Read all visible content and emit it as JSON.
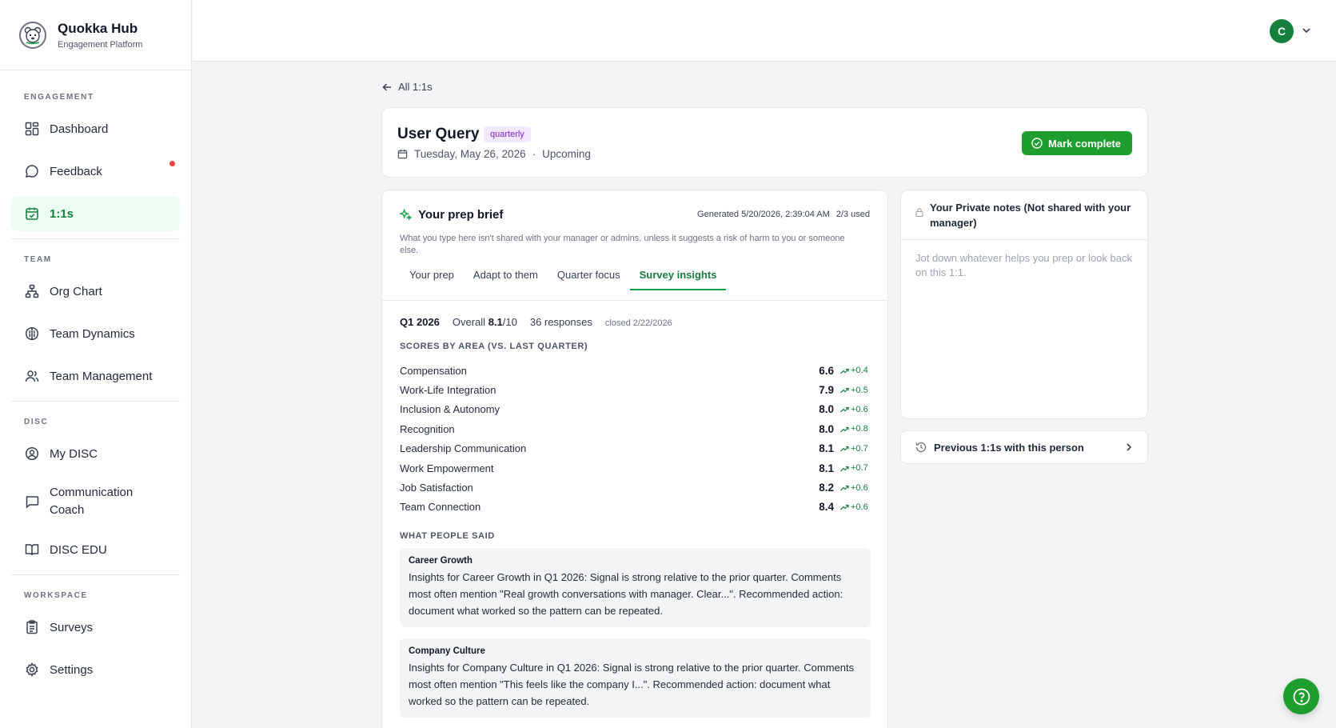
{
  "brand": {
    "name": "Quokka Hub",
    "subtitle": "Engagement Platform"
  },
  "sidebar": {
    "sections": [
      {
        "label": "ENGAGEMENT",
        "items": [
          {
            "label": "Dashboard",
            "icon": "dashboard-icon"
          },
          {
            "label": "Feedback",
            "icon": "chat-bubble-icon",
            "notification": true
          },
          {
            "label": "1:1s",
            "icon": "calendar-check-icon",
            "active": true
          }
        ]
      },
      {
        "label": "TEAM",
        "items": [
          {
            "label": "Org Chart",
            "icon": "org-chart-icon"
          },
          {
            "label": "Team Dynamics",
            "icon": "brain-icon"
          },
          {
            "label": "Team Management",
            "icon": "users-icon"
          }
        ]
      },
      {
        "label": "DISC",
        "items": [
          {
            "label": "My DISC",
            "icon": "user-circle-icon"
          },
          {
            "label": "Communication Coach",
            "icon": "message-square-icon"
          },
          {
            "label": "DISC EDU",
            "icon": "book-open-icon"
          }
        ]
      },
      {
        "label": "WORKSPACE",
        "items": [
          {
            "label": "Surveys",
            "icon": "clipboard-icon"
          },
          {
            "label": "Settings",
            "icon": "gear-icon"
          }
        ]
      }
    ]
  },
  "topbar": {
    "avatar_initial": "C"
  },
  "back_link": "All 1:1s",
  "meeting": {
    "title": "User Query",
    "badge": "quarterly",
    "date": "Tuesday, May 26, 2026",
    "separator": "·",
    "status": "Upcoming",
    "complete_label": "Mark complete"
  },
  "brief": {
    "title": "Your prep brief",
    "generated": "Generated 5/20/2026, 2:39:04 AM",
    "usage": "2/3 used",
    "disclaimer": "What you type here isn't shared with your manager or admins, unless it suggests a risk of harm to you or someone else.",
    "tabs": [
      "Your prep",
      "Adapt to them",
      "Quarter focus",
      "Survey insights"
    ],
    "active_tab": 3,
    "summary": {
      "quarter": "Q1 2026",
      "overall_label": "Overall",
      "overall_value": "8.1",
      "overall_suffix": "/10",
      "responses": "36 responses",
      "closed": "closed 2/22/2026"
    },
    "scores_label": "SCORES BY AREA (VS. LAST QUARTER)",
    "scores": [
      {
        "name": "Compensation",
        "value": "6.6",
        "delta": "+0.4"
      },
      {
        "name": "Work-Life Integration",
        "value": "7.9",
        "delta": "+0.5"
      },
      {
        "name": "Inclusion & Autonomy",
        "value": "8.0",
        "delta": "+0.6"
      },
      {
        "name": "Recognition",
        "value": "8.0",
        "delta": "+0.8"
      },
      {
        "name": "Leadership Communication",
        "value": "8.1",
        "delta": "+0.7"
      },
      {
        "name": "Work Empowerment",
        "value": "8.1",
        "delta": "+0.7"
      },
      {
        "name": "Job Satisfaction",
        "value": "8.2",
        "delta": "+0.6"
      },
      {
        "name": "Team Connection",
        "value": "8.4",
        "delta": "+0.6"
      }
    ],
    "said_label": "WHAT PEOPLE SAID",
    "quotes": [
      {
        "title": "Career Growth",
        "body": "Insights for Career Growth in Q1 2026: Signal is strong relative to the prior quarter. Comments most often mention \"Real growth conversations with manager. Clear...\". Recommended action: document what worked so the pattern can be repeated."
      },
      {
        "title": "Company Culture",
        "body": "Insights for Company Culture in Q1 2026: Signal is strong relative to the prior quarter. Comments most often mention \"This feels like the company I...\". Recommended action: document what worked so the pattern can be repeated."
      }
    ]
  },
  "notes": {
    "title": "Your Private notes (Not shared with your manager)",
    "placeholder": "Jot down whatever helps you prep or look back on this 1:1."
  },
  "previous_label": "Previous 1:1s with this person",
  "colors": {
    "accent": "#1e9e2e",
    "active_bg": "#ecfdf3",
    "badge_bg": "#f3e8ff",
    "badge_text": "#7e22ce",
    "notification": "#ef4444"
  }
}
